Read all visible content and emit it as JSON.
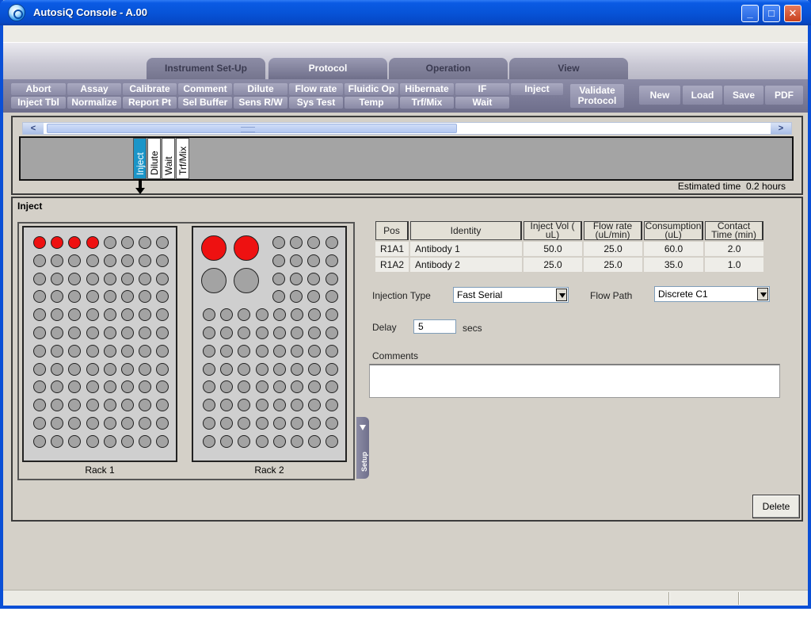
{
  "window": {
    "title": "AutosiQ Console - A.00",
    "controls": [
      "_",
      "□",
      "✕"
    ]
  },
  "tabs": [
    "Instrument Set-Up",
    "Protocol",
    "Operation",
    "View"
  ],
  "active_tab": "Protocol",
  "toolbar": {
    "row1": [
      "Abort",
      "Assay",
      "Calibrate",
      "Comment",
      "Dilute",
      "Flow rate",
      "Fluidic Op",
      "Hibernate",
      "IF",
      "Inject"
    ],
    "row2": [
      "Inject Tbl",
      "Normalize",
      "Report Pt",
      "Sel Buffer",
      "Sens R/W",
      "Sys Test",
      "Temp",
      "Trf/Mix",
      "Wait"
    ],
    "validate_line1": "Validate",
    "validate_line2": "Protocol",
    "file_buttons": [
      "New",
      "Load",
      "Save",
      "PDF"
    ]
  },
  "timeline": {
    "steps": [
      "Inject",
      "Dilute",
      "Wait",
      "Trf/Mix"
    ],
    "selected_step": "Inject",
    "estimated_time_label": "Estimated time",
    "estimated_time_value": "0.2 hours"
  },
  "panel": {
    "title": "Inject",
    "rack1_label": "Rack 1",
    "rack2_label": "Rack 2",
    "rack1_filled_wells": [
      "A1",
      "A2",
      "A3",
      "A4"
    ],
    "rack2_filled_wells": [
      "A1",
      "A2"
    ],
    "setup_tab": "Setup",
    "table": {
      "headers": [
        "Pos",
        "Identity",
        "Inject Vol ( uL)",
        "Flow rate (uL/min)",
        "Consumption (uL)",
        "Contact Time (min)"
      ],
      "rows": [
        [
          "R1A1",
          "Antibody 1",
          "50.0",
          "25.0",
          "60.0",
          "2.0"
        ],
        [
          "R1A2",
          "Antibody 2",
          "25.0",
          "25.0",
          "35.0",
          "1.0"
        ]
      ]
    },
    "injection_type_label": "Injection Type",
    "injection_type_value": "Fast Serial",
    "flow_path_label": "Flow Path",
    "flow_path_value": "Discrete C1",
    "delay_label": "Delay",
    "delay_value": "5",
    "delay_unit": "secs",
    "comments_label": "Comments",
    "comments_value": "",
    "delete_label": "Delete"
  },
  "colors": {
    "accent": "#1b95c8",
    "filled_well": "#ee1111",
    "empty_well": "#a3a3a3",
    "toolbar": "#8a8aa6",
    "titlebar": "#0754d8"
  }
}
